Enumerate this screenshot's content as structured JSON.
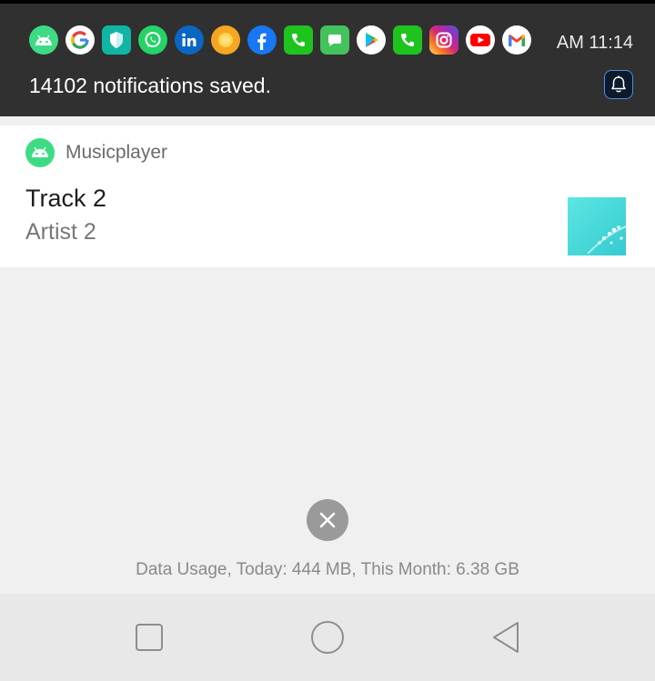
{
  "status_bar": {
    "clock": "AM 11:14",
    "notification_icons": [
      "android-icon",
      "google-icon",
      "shield-icon",
      "whatsapp-icon",
      "linkedin-icon",
      "circle-app-icon",
      "facebook-icon",
      "phone-icon",
      "messages-icon",
      "play-store-icon",
      "phone-icon",
      "instagram-icon",
      "youtube-icon",
      "gmail-icon"
    ],
    "summary": "14102 notifications saved."
  },
  "notification": {
    "app_name": "Musicplayer",
    "title": "Track 2",
    "artist": "Artist 2",
    "accent_color": "#3ddc84"
  },
  "footer": {
    "data_usage": "Data Usage, Today: 444 MB, This Month: 6.38 GB"
  },
  "nav_bar": {
    "buttons": [
      "recents-icon",
      "home-icon",
      "back-icon"
    ]
  }
}
